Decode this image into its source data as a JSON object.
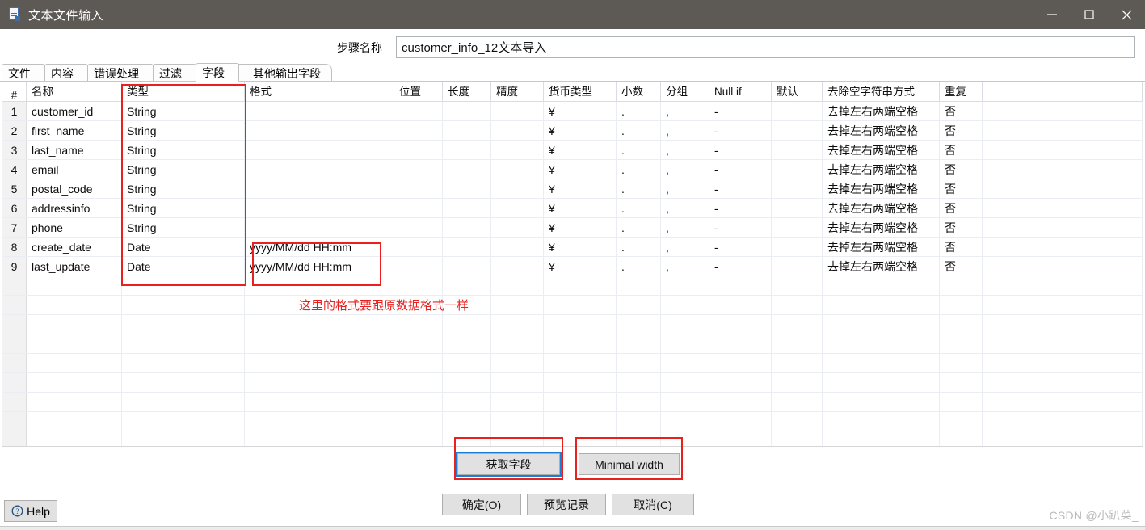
{
  "window": {
    "title": "文本文件输入",
    "icon": "file-text-icon",
    "minimize_label": "—",
    "maximize_label": "□",
    "close_label": "✕"
  },
  "step": {
    "label": "步骤名称",
    "value": "customer_info_12文本导入",
    "placeholder": "步骤名称"
  },
  "tabs": [
    {
      "label": "文件",
      "active": false
    },
    {
      "label": "内容",
      "active": false
    },
    {
      "label": "错误处理",
      "active": false
    },
    {
      "label": "过滤",
      "active": false
    },
    {
      "label": "字段",
      "active": true
    },
    {
      "label": "其他输出字段",
      "active": false
    }
  ],
  "table": {
    "columns": [
      "#",
      "名称",
      "类型",
      "格式",
      "位置",
      "长度",
      "精度",
      "货币类型",
      "小数",
      "分组",
      "Null if",
      "默认",
      "去除空字符串方式",
      "重复",
      ""
    ],
    "rows": [
      {
        "n": "1",
        "name": "customer_id",
        "type": "String",
        "format": "",
        "position": "",
        "length": "",
        "precision": "",
        "currency": "¥",
        "decimal": ".",
        "group": ",",
        "nullif": "-",
        "default": "",
        "trim": "去掉左右两端空格",
        "repeat": "否"
      },
      {
        "n": "2",
        "name": "first_name",
        "type": "String",
        "format": "",
        "position": "",
        "length": "",
        "precision": "",
        "currency": "¥",
        "decimal": ".",
        "group": ",",
        "nullif": "-",
        "default": "",
        "trim": "去掉左右两端空格",
        "repeat": "否"
      },
      {
        "n": "3",
        "name": "last_name",
        "type": "String",
        "format": "",
        "position": "",
        "length": "",
        "precision": "",
        "currency": "¥",
        "decimal": ".",
        "group": ",",
        "nullif": "-",
        "default": "",
        "trim": "去掉左右两端空格",
        "repeat": "否"
      },
      {
        "n": "4",
        "name": "email",
        "type": "String",
        "format": "",
        "position": "",
        "length": "",
        "precision": "",
        "currency": "¥",
        "decimal": ".",
        "group": ",",
        "nullif": "-",
        "default": "",
        "trim": "去掉左右两端空格",
        "repeat": "否"
      },
      {
        "n": "5",
        "name": "postal_code",
        "type": "String",
        "format": "",
        "position": "",
        "length": "",
        "precision": "",
        "currency": "¥",
        "decimal": ".",
        "group": ",",
        "nullif": "-",
        "default": "",
        "trim": "去掉左右两端空格",
        "repeat": "否"
      },
      {
        "n": "6",
        "name": "addressinfo",
        "type": "String",
        "format": "",
        "position": "",
        "length": "",
        "precision": "",
        "currency": "¥",
        "decimal": ".",
        "group": ",",
        "nullif": "-",
        "default": "",
        "trim": "去掉左右两端空格",
        "repeat": "否"
      },
      {
        "n": "7",
        "name": "phone",
        "type": "String",
        "format": "",
        "position": "",
        "length": "",
        "precision": "",
        "currency": "¥",
        "decimal": ".",
        "group": ",",
        "nullif": "-",
        "default": "",
        "trim": "去掉左右两端空格",
        "repeat": "否"
      },
      {
        "n": "8",
        "name": "create_date",
        "type": "Date",
        "format": "yyyy/MM/dd HH:mm",
        "position": "",
        "length": "",
        "precision": "",
        "currency": "¥",
        "decimal": ".",
        "group": ",",
        "nullif": "-",
        "default": "",
        "trim": "去掉左右两端空格",
        "repeat": "否"
      },
      {
        "n": "9",
        "name": "last_update",
        "type": "Date",
        "format": "yyyy/MM/dd HH:mm",
        "position": "",
        "length": "",
        "precision": "",
        "currency": "¥",
        "decimal": ".",
        "group": ",",
        "nullif": "-",
        "default": "",
        "trim": "去掉左右两端空格",
        "repeat": "否"
      }
    ],
    "empty_row_count": 9,
    "sort_indicator": "⌃"
  },
  "annotations": {
    "note_format": "这里的格式要跟原数据格式一样",
    "color": "#e8201e"
  },
  "grid_buttons": {
    "get_fields": "获取字段",
    "minimal_width": "Minimal width"
  },
  "dialog_buttons": {
    "help": "Help",
    "ok": "确定(O)",
    "preview": "预览记录",
    "cancel": "取消(C)"
  },
  "watermark": "CSDN @小趴菜_"
}
